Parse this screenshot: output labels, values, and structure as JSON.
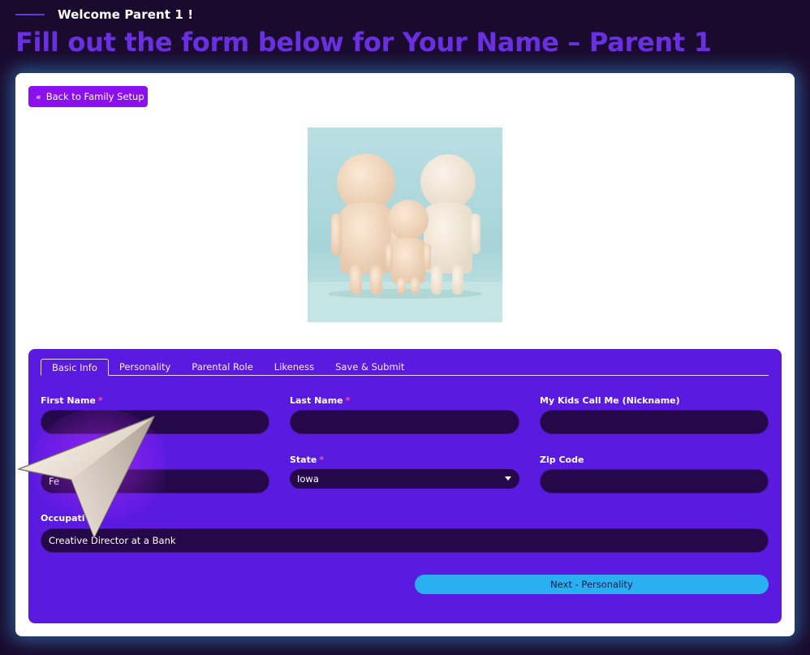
{
  "header": {
    "welcome": "Welcome Parent 1 !",
    "title": "Fill out the form below for Your Name – Parent 1"
  },
  "card": {
    "back_label": "Back to Family Setup",
    "back_icon": "double-chevron-left-icon"
  },
  "tabs": [
    {
      "label": "Basic Info",
      "active": true
    },
    {
      "label": "Personality",
      "active": false
    },
    {
      "label": "Parental Role",
      "active": false
    },
    {
      "label": "Likeness",
      "active": false
    },
    {
      "label": "Save & Submit",
      "active": false
    }
  ],
  "form": {
    "first_name": {
      "label": "First Name",
      "required_mark": "*",
      "value": ""
    },
    "last_name": {
      "label": "Last Name",
      "required_mark": "*",
      "value": ""
    },
    "nickname": {
      "label": "My Kids Call Me (Nickname)",
      "value": ""
    },
    "city": {
      "value": "Fe"
    },
    "state": {
      "label": "State",
      "required_mark": "*",
      "value": "Iowa"
    },
    "zip": {
      "label": "Zip Code",
      "value": ""
    },
    "occupation": {
      "label": "Occupati",
      "value": "Creative Director at a Bank"
    },
    "next_label": "Next - Personality"
  },
  "colors": {
    "page_bg": "#1a0b2e",
    "title": "#6a2fe0",
    "panel": "#5b1ae0",
    "input_bg": "#24084a",
    "accent_button": "#8a10f0",
    "next_button": "#2ab0f0",
    "required": "#ff4d9a"
  }
}
